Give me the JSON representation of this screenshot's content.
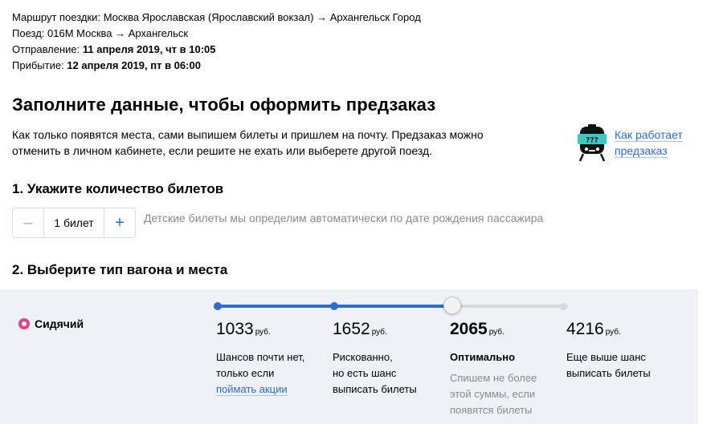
{
  "trip": {
    "route_label": "Маршрут поездки:",
    "route_value": "Москва Ярославская (Ярославский вокзал) → Архангельск Город",
    "train_label": "Поезд:",
    "train_value": "016М Москва → Архангельск",
    "departure_label": "Отправление:",
    "departure_value": "11 апреля 2019, чт в 10:05",
    "arrival_label": "Прибытие:",
    "arrival_value": "12 апреля 2019, пт в 06:00"
  },
  "header": {
    "title": "Заполните данные, чтобы оформить предзаказ",
    "desc_line1": "Как только появятся места, сами выпишем билеты и пришлем на почту. Предзаказ можно",
    "desc_line2": "отменить в личном кабинете, если решите не ехать или выберете другой поезд.",
    "how_link_line1": "Как работает",
    "how_link_line2": "предзаказ",
    "mascot_icon": "train-mascot-icon"
  },
  "tickets": {
    "step_title": "1. Укажите количество билетов",
    "minus_label": "–",
    "value": "1 билет",
    "plus_label": "+",
    "hint": "Детские билеты мы определим автоматически по дате рождения пассажира"
  },
  "car": {
    "step_title": "2. Выберите тип вагона и места",
    "type_label": "Сидячий",
    "slider": {
      "selected_index": 2,
      "active_color": "#2b6ecf",
      "inactive_color": "#d9d9d9"
    },
    "options": [
      {
        "price": "1033",
        "currency": "руб.",
        "line1": "Шансов почти нет,",
        "line2": "только если",
        "link": "поймать акции"
      },
      {
        "price": "1652",
        "currency": "руб.",
        "line1": "Рискованно,",
        "line2": "но есть шанс",
        "line3": "выписать билеты"
      },
      {
        "price": "2065",
        "currency": "руб.",
        "label": "Оптимально",
        "note1": "Спишем не более",
        "note2": "этой суммы, если",
        "note3": "появятся билеты"
      },
      {
        "price": "4216",
        "currency": "руб.",
        "line1": "Еще выше шанс",
        "line2": "выписать билеты"
      }
    ]
  },
  "colors": {
    "accent": "#2b6ecf",
    "radio": "#e83e8c",
    "mascot_teal": "#3cc9c4",
    "panel_bg": "#eef1f5"
  }
}
